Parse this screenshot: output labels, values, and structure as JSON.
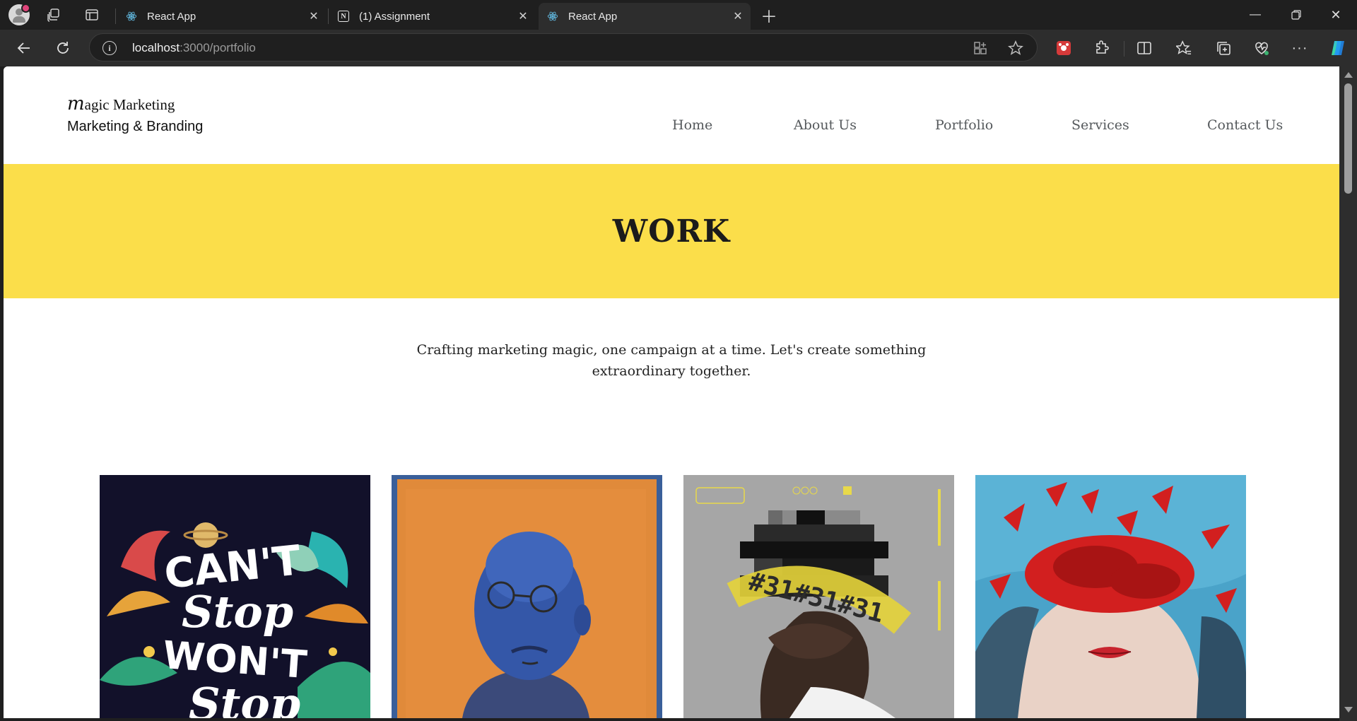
{
  "browser": {
    "tabs": [
      {
        "label": "React App",
        "favicon": "react-icon"
      },
      {
        "label": "(1) Assignment",
        "favicon": "notion-icon"
      },
      {
        "label": "React App",
        "favicon": "react-icon",
        "active": true
      }
    ],
    "address": {
      "host": "localhost",
      "path": ":3000/portfolio"
    }
  },
  "site": {
    "brand": {
      "name_initial": "m",
      "name_rest": "agic Marketing",
      "tagline": "Marketing & Branding"
    },
    "nav": [
      {
        "label": "Home"
      },
      {
        "label": "About Us"
      },
      {
        "label": "Portfolio"
      },
      {
        "label": "Services"
      },
      {
        "label": "Contact Us"
      }
    ],
    "hero": {
      "title": "WORK",
      "background": "#fbde4a"
    },
    "intro": "Crafting marketing magic, one campaign at a time. Let's create something extraordinary together.",
    "gallery": [
      {
        "name": "cant-stop-wont-stop-poster",
        "text_lines": [
          "CAN'T",
          "Stop",
          "WON'T",
          "Stop"
        ]
      },
      {
        "name": "blue-man-portrait"
      },
      {
        "name": "pixelated-face-poster",
        "text_lines": [
          "#31#31#31"
        ]
      },
      {
        "name": "red-petals-portrait"
      }
    ]
  }
}
